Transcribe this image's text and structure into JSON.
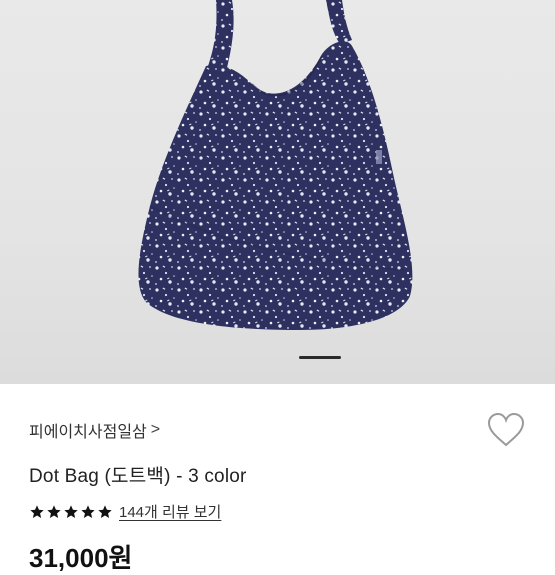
{
  "product": {
    "store_name": "피에이치사점일삼",
    "store_chevron": ">",
    "title": "Dot Bag (도트백) - 3 color",
    "rating_stars": 5,
    "review_link": "144개 리뷰 보기",
    "price": "31,000원"
  },
  "colors": {
    "bag_navy": "#2e3160",
    "background": "#e6e6e6",
    "star": "#111111"
  },
  "icons": {
    "heart": "heart-outline-icon",
    "star": "star-filled-icon"
  }
}
